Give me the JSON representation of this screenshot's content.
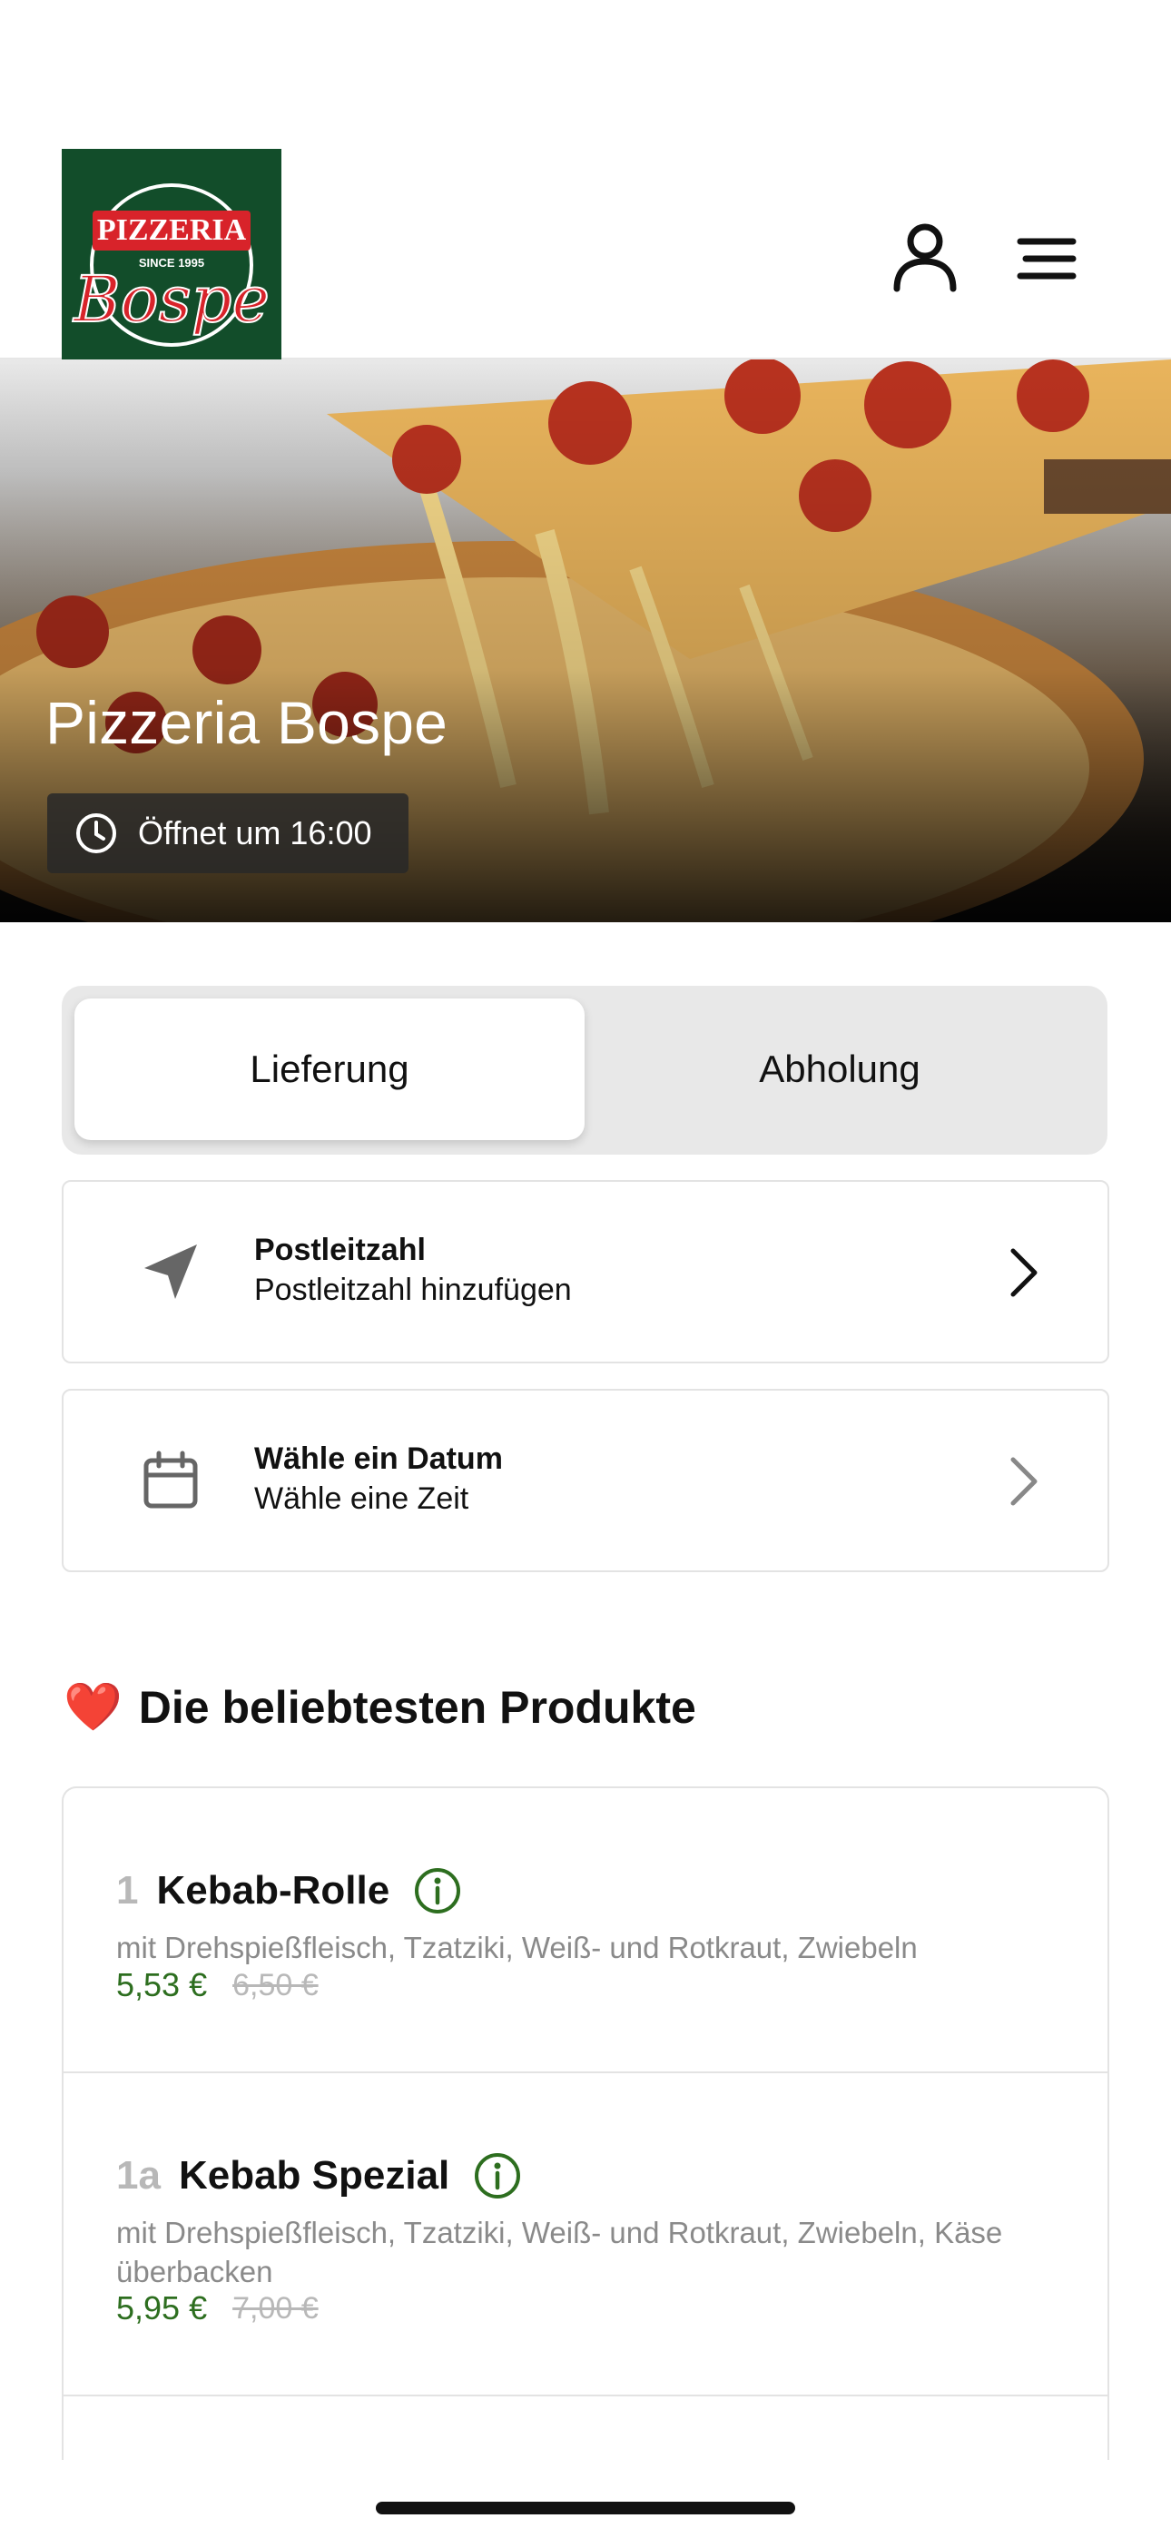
{
  "brand": {
    "logo_line1": "PIZZERIA",
    "logo_since": "SINCE 1995",
    "logo_script": "Bospe",
    "logo_bg": "#124d2a",
    "logo_red": "#d8232a"
  },
  "header": {
    "account_icon": "user-icon",
    "menu_icon": "hamburger-menu-icon"
  },
  "hero": {
    "title": "Pizzeria Bospe",
    "hours_icon": "clock-icon",
    "hours_text": "Öffnet um 16:00"
  },
  "order_mode": {
    "options": [
      "Lieferung",
      "Abholung"
    ],
    "selected": "Lieferung"
  },
  "postal": {
    "icon": "location-arrow-icon",
    "title": "Postleitzahl",
    "subtitle": "Postleitzahl hinzufügen"
  },
  "date": {
    "icon": "calendar-icon",
    "title": "Wähle ein Datum",
    "subtitle": "Wähle eine Zeit"
  },
  "popular": {
    "heading_emoji": "❤️",
    "heading": "Die beliebtesten Produkte",
    "products": [
      {
        "number": "1",
        "name": "Kebab-Rolle",
        "description": "mit Drehspießfleisch, Tzatziki, Weiß- und Rotkraut, Zwiebeln",
        "price": "5,53 €",
        "old_price": "6,50 €"
      },
      {
        "number": "1a",
        "name": "Kebab Spezial",
        "description": "mit Drehspießfleisch, Tzatziki, Weiß- und Rotkraut, Zwiebeln, Käse überbacken",
        "price": "5,95 €",
        "old_price": "7,00 €"
      }
    ]
  },
  "colors": {
    "accent_green": "#2d6e1f",
    "segment_bg": "#e8e8e8"
  }
}
